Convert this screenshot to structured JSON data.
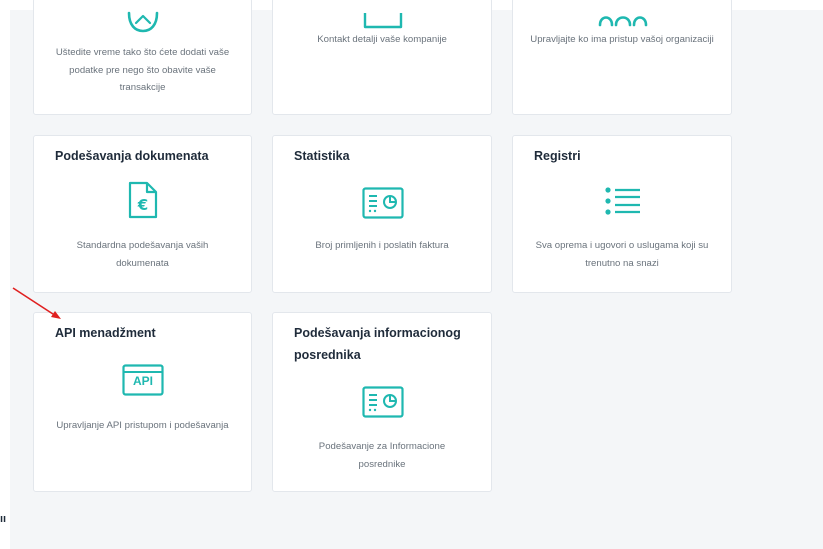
{
  "cards_top_partial": [
    {
      "description": "Uštedite vreme tako što ćete dodati vaše podatke pre nego što obavite vaše transakcije",
      "icon": "tag-icon"
    },
    {
      "description": "Kontakt detalji vaše kompanije",
      "icon": "id-card-icon"
    },
    {
      "description": "Upravljajte ko ima pristup vašoj organizaciji",
      "icon": "users-icon"
    }
  ],
  "cards": [
    {
      "title": "Podešavanja dokumenata",
      "description": "Standardna podešavanja vaših dokumenata",
      "icon": "euro-document-icon"
    },
    {
      "title": "Statistika",
      "description": "Broj primljenih i poslatih faktura",
      "icon": "statistics-icon"
    },
    {
      "title": "Registri",
      "description": "Sva oprema i ugovori o uslugama koji su trenutno na snazi",
      "icon": "list-icon"
    },
    {
      "title": "API menadžment",
      "description": "Upravljanje API pristupom i podešavanja",
      "icon": "api-window-icon",
      "icon_text": "API"
    },
    {
      "title": "Podešavanja informacionog posrednika",
      "description": "Podešavanje za Informacione posrednike",
      "icon": "statistics-icon"
    }
  ],
  "edge_glyph": "ıı",
  "colors": {
    "accent": "#1fb8b0",
    "title": "#1f2b3a",
    "text": "#6a737c",
    "annotation_arrow": "#e02020"
  }
}
